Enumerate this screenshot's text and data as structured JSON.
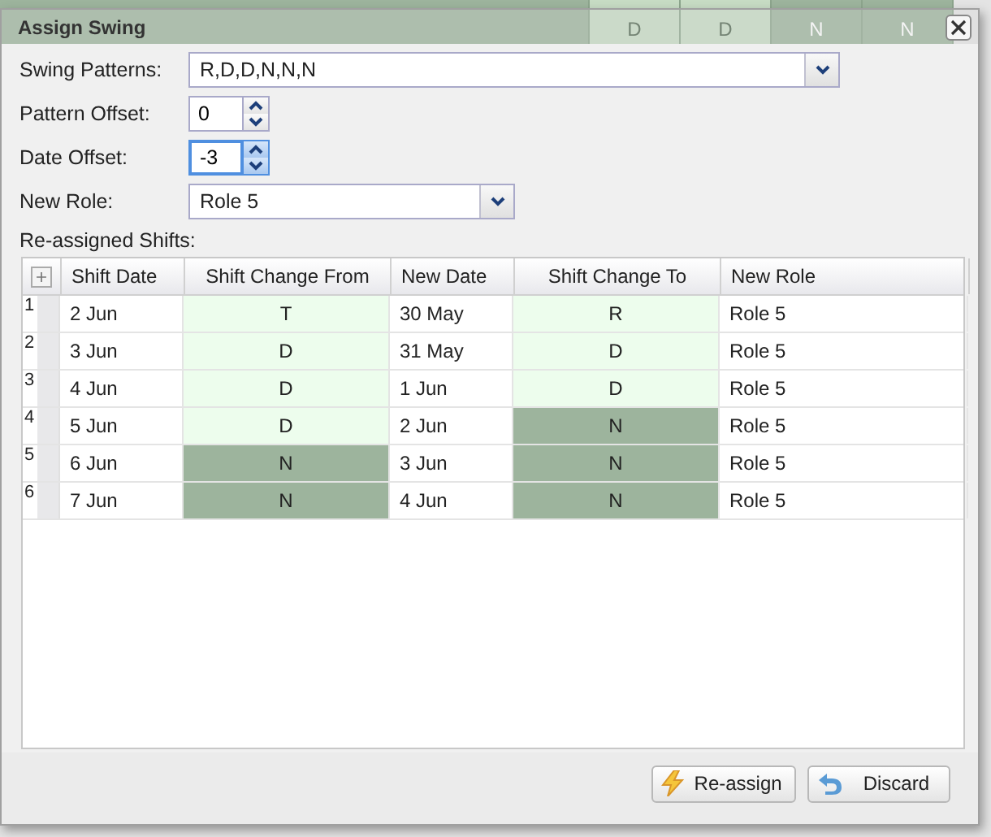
{
  "backdrop": {
    "cells": [
      {
        "text": "",
        "color": "#9db49d"
      },
      {
        "text": "D",
        "color": "#c7dcc4"
      },
      {
        "text": "D",
        "color": "#c7dcc4"
      },
      {
        "text": "N",
        "color": "#9db49d"
      },
      {
        "text": "N",
        "color": "#9db49d"
      }
    ]
  },
  "dialog": {
    "title": "Assign Swing",
    "fields": [
      {
        "kind": "select",
        "label": "Swing Patterns:",
        "value": "R,D,D,N,N,N",
        "wide": true
      },
      {
        "kind": "spinner",
        "label": "Pattern Offset:",
        "value": "0",
        "focused": false
      },
      {
        "kind": "spinner",
        "label": "Date Offset:",
        "value": "-3",
        "focused": true
      },
      {
        "kind": "select",
        "label": "New Role:",
        "value": "Role 5",
        "wide": false
      }
    ],
    "table_label": "Re-assigned Shifts:",
    "table": {
      "columns": [
        {
          "label": "Shift Date",
          "kind": "text"
        },
        {
          "label": "Shift Change From",
          "kind": "shift"
        },
        {
          "label": "New Date",
          "kind": "text"
        },
        {
          "label": "Shift Change To",
          "kind": "shift"
        },
        {
          "label": "New Role",
          "kind": "text"
        }
      ],
      "rows": [
        {
          "number": "1",
          "cells": [
            {
              "text": "2 Jun"
            },
            {
              "text": "T",
              "color": "#edfded"
            },
            {
              "text": "30 May"
            },
            {
              "text": "R",
              "color": "#edfded"
            },
            {
              "text": "Role 5"
            }
          ]
        },
        {
          "number": "2",
          "cells": [
            {
              "text": "3 Jun"
            },
            {
              "text": "D",
              "color": "#edfded"
            },
            {
              "text": "31 May"
            },
            {
              "text": "D",
              "color": "#edfded"
            },
            {
              "text": "Role 5"
            }
          ]
        },
        {
          "number": "3",
          "cells": [
            {
              "text": "4 Jun"
            },
            {
              "text": "D",
              "color": "#edfded"
            },
            {
              "text": "1 Jun"
            },
            {
              "text": "D",
              "color": "#edfded"
            },
            {
              "text": "Role 5"
            }
          ]
        },
        {
          "number": "4",
          "cells": [
            {
              "text": "5 Jun"
            },
            {
              "text": "D",
              "color": "#edfded"
            },
            {
              "text": "2 Jun"
            },
            {
              "text": "N",
              "color": "#9db49d"
            },
            {
              "text": "Role 5"
            }
          ]
        },
        {
          "number": "5",
          "cells": [
            {
              "text": "6 Jun"
            },
            {
              "text": "N",
              "color": "#9db49d"
            },
            {
              "text": "3 Jun"
            },
            {
              "text": "N",
              "color": "#9db49d"
            },
            {
              "text": "Role 5"
            }
          ]
        },
        {
          "number": "6",
          "cells": [
            {
              "text": "7 Jun"
            },
            {
              "text": "N",
              "color": "#9db49d"
            },
            {
              "text": "4 Jun"
            },
            {
              "text": "N",
              "color": "#9db49d"
            },
            {
              "text": "Role 5"
            }
          ]
        }
      ]
    },
    "buttons": [
      {
        "kind": "reassign",
        "label": "Re-assign"
      },
      {
        "kind": "discard",
        "label": "Discard"
      }
    ]
  }
}
